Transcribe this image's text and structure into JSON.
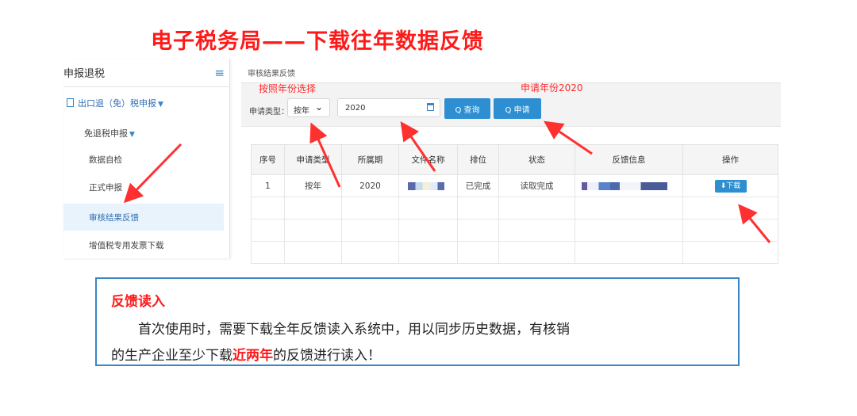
{
  "slide": {
    "title": "电子税务局——下载往年数据反馈"
  },
  "sidebar": {
    "header": "申报退税",
    "toggle_icon": "≡",
    "items": [
      {
        "label": "出口退（免）税申报"
      },
      {
        "label": "免退税申报"
      },
      {
        "label": "数据自检"
      },
      {
        "label": "正式申报"
      },
      {
        "label": "审核结果反馈"
      },
      {
        "label": "增值税专用发票下载"
      }
    ]
  },
  "main": {
    "breadcrumb": "审核结果反馈",
    "filter": {
      "type_label": "申请类型：",
      "type_value": "按年",
      "year_value": "2020",
      "query_label": "Q 查询",
      "apply_label": "Q 申请"
    },
    "annotations": {
      "select_year": "按照年份选择",
      "apply_year": "申请年份2020"
    },
    "table": {
      "headers": [
        "序号",
        "申请类型",
        "所属期",
        "文件名称",
        "排位",
        "状态",
        "反馈信息",
        "操作"
      ],
      "rows": [
        {
          "no": "1",
          "type": "按年",
          "period": "2020",
          "rank": "已完成",
          "status": "读取完成",
          "action": "⬇下载"
        }
      ]
    }
  },
  "info": {
    "title": "反馈读入",
    "line1": "首次使用时，需要下载全年反馈读入系统中，用以同步历史数据，有核销",
    "line2_pre": "的生产企业至少下载",
    "line2_hl": "近两年",
    "line2_post": "的反馈进行读入！"
  },
  "colors": {
    "accent_red": "#ff1a1a",
    "primary_blue": "#2d8ed1",
    "border_blue": "#3a86c8"
  }
}
